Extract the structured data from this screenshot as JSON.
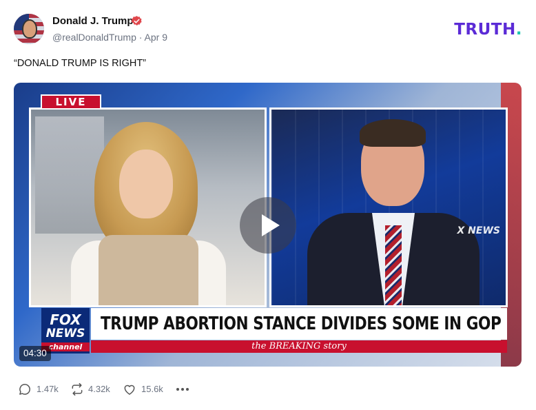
{
  "author": {
    "display_name": "Donald J. Trump",
    "handle": "@realDonaldTrump",
    "separator": "·",
    "date": "Apr 9",
    "avatar_icon": "flag-portrait-avatar",
    "verified_icon": "verified-badge-icon",
    "verified_color": "#e0474c"
  },
  "brand": {
    "logo_text": "TRUTH",
    "logo_dot": ".",
    "logo_color": "#5b2bd6",
    "dot_color": "#1ec7b0"
  },
  "post": {
    "text": "“DONALD TRUMP IS RIGHT”"
  },
  "video": {
    "live_label": "LIVE",
    "channel_logo_line1": "FOX",
    "channel_logo_line2": "NEWS",
    "channel_logo_line3": "channel",
    "bug_text": "X NEWS",
    "headline": "TRUMP ABORTION STANCE DIVIDES SOME IN GOP",
    "story_tag": "the BREAKING story",
    "duration": "04:30",
    "play_icon": "play-icon"
  },
  "actions": {
    "replies": {
      "icon": "reply-icon",
      "count": "1.47k"
    },
    "retruths": {
      "icon": "retruth-icon",
      "count": "4.32k"
    },
    "likes": {
      "icon": "heart-icon",
      "count": "15.6k"
    },
    "more": {
      "icon": "more-icon"
    }
  }
}
